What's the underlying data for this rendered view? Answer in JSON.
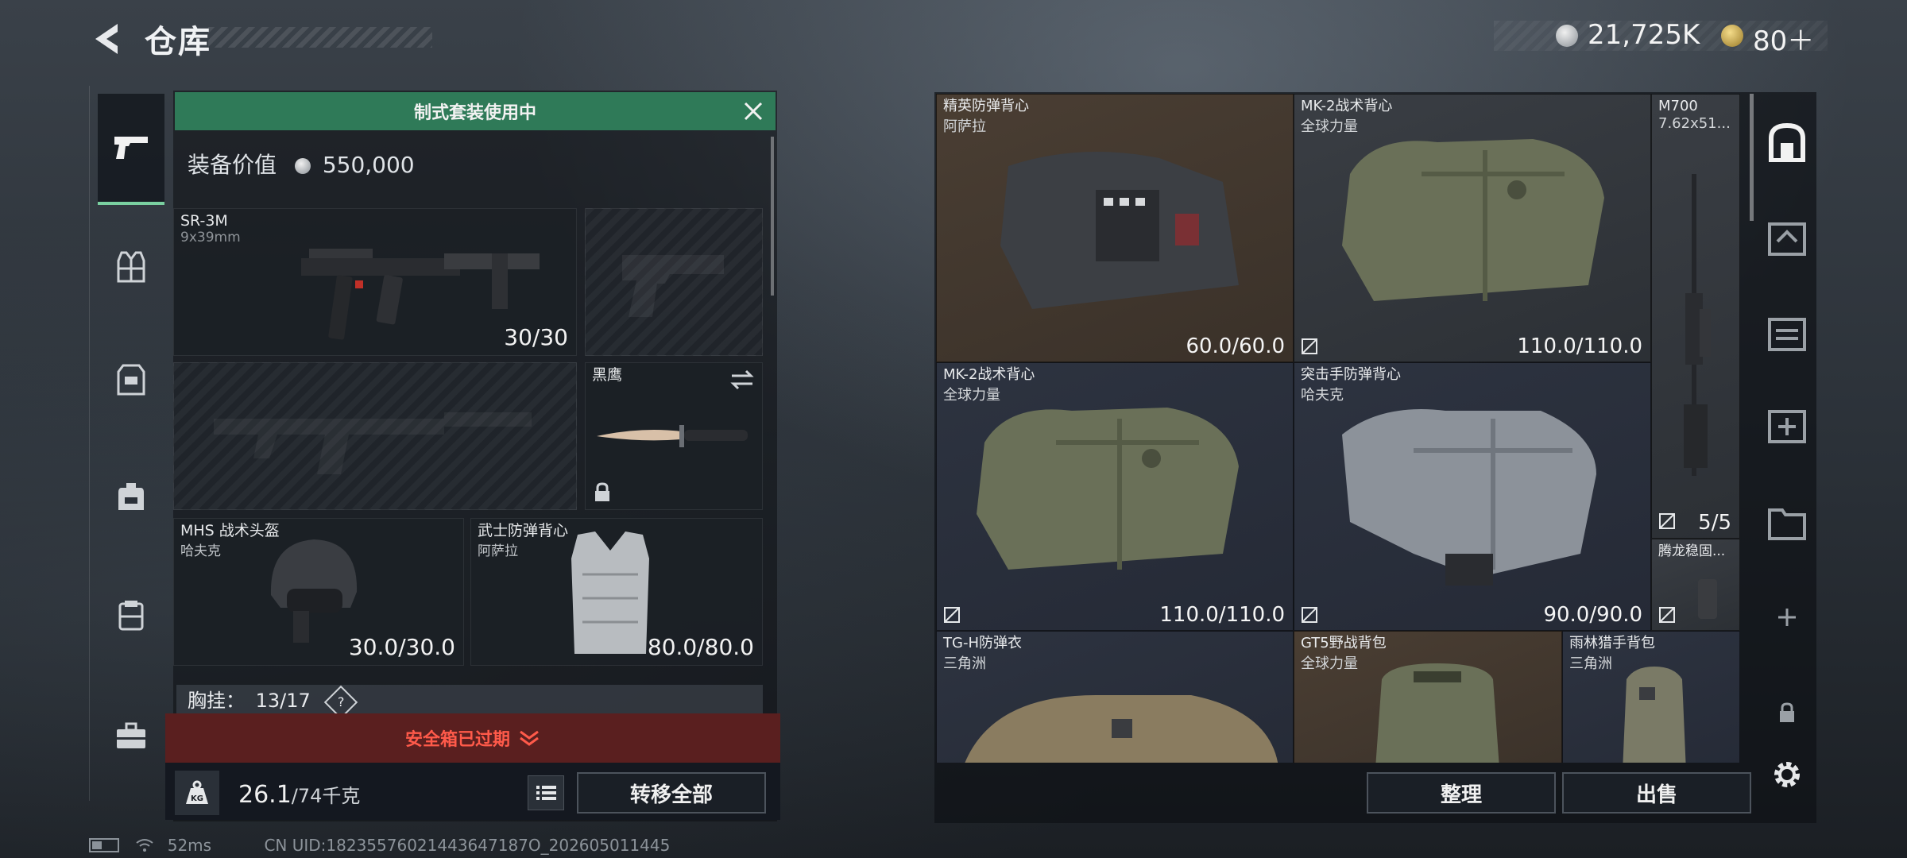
{
  "header": {
    "title": "仓库",
    "currency_amount": "21,725K",
    "token_amount": "80＋",
    "colors": {
      "currency": "#c8ccd0",
      "token": "#c9a548"
    }
  },
  "left_nav": {
    "items": [
      {
        "icon": "pistol-icon",
        "active": true
      },
      {
        "icon": "vest-icon",
        "active": false
      },
      {
        "icon": "armor-icon",
        "active": false
      },
      {
        "icon": "backpack-icon",
        "active": false
      },
      {
        "icon": "rig-icon",
        "active": false
      },
      {
        "icon": "case-icon",
        "active": false
      }
    ]
  },
  "loadout": {
    "banner": "制式套装使用中",
    "value_label": "装备价值",
    "value": "550,000",
    "primary_weapon": {
      "name": "SR-3M",
      "caliber": "9x39mm",
      "ammo": "30/30"
    },
    "melee": {
      "name": "黑鹰"
    },
    "helmet": {
      "name": "MHS 战术头盔",
      "brand": "哈夫克",
      "durability": "30.0/30.0"
    },
    "armor": {
      "name": "武士防弹背心",
      "brand": "阿萨拉",
      "durability": "80.0/80.0"
    },
    "chest_rig": {
      "label": "胸挂：",
      "capacity": "13/17",
      "help": "?"
    },
    "alert": "安全箱已过期",
    "weight": {
      "current": "26.1",
      "max_unit": "/74千克",
      "icon_text": "KG"
    },
    "transfer_all": "转移全部"
  },
  "warehouse": {
    "items": [
      {
        "name": "精英防弹背心",
        "brand": "阿萨拉",
        "value": "60.0/60.0"
      },
      {
        "name": "MK-2战术背心",
        "brand": "全球力量",
        "value": "110.0/110.0"
      },
      {
        "name": "M700",
        "brand": "7.62x51...",
        "value": "5/5"
      },
      {
        "name": "MK-2战术背心",
        "brand": "全球力量",
        "value": "110.0/110.0"
      },
      {
        "name": "突击手防弹背心",
        "brand": "哈夫克",
        "value": "90.0/90.0"
      },
      {
        "name": "腾龙稳固...",
        "brand": "",
        "value": ""
      },
      {
        "name": "TG-H防弹衣",
        "brand": "三角洲",
        "value": ""
      },
      {
        "name": "GT5野战背包",
        "brand": "全球力量",
        "value": ""
      },
      {
        "name": "雨林猎手背包",
        "brand": "三角洲",
        "value": ""
      }
    ],
    "sort_button": "整理",
    "sell_button": "出售"
  },
  "status_bar": {
    "ping": "52ms",
    "uid": "CN UID:18235576021443647187O_202605011445"
  }
}
